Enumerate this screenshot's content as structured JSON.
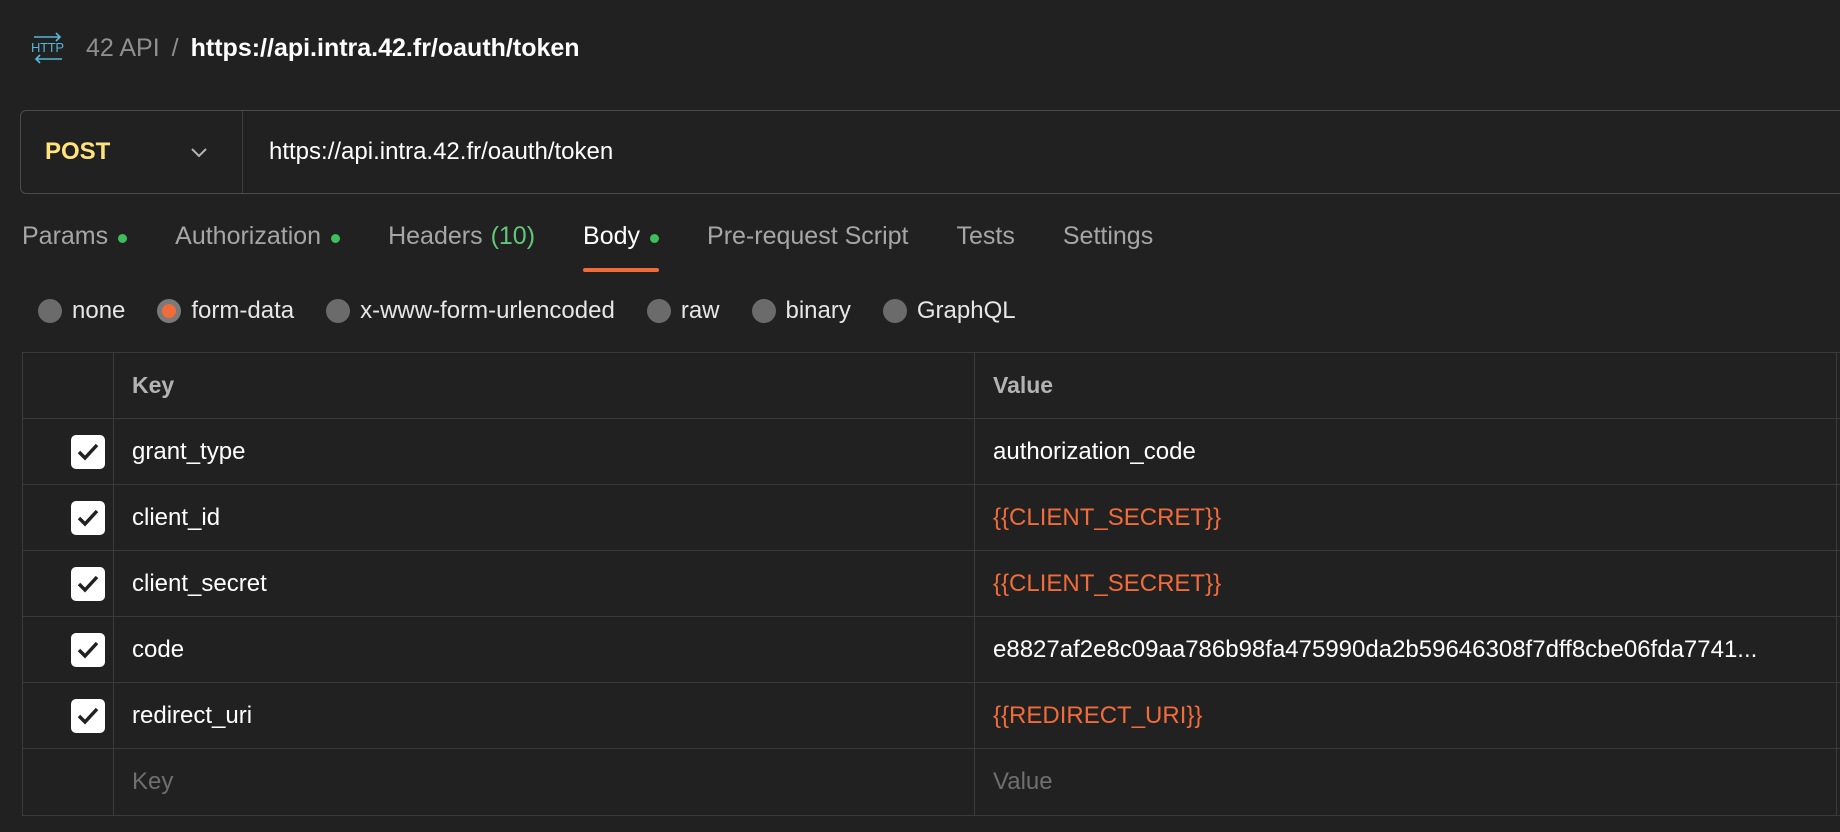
{
  "breadcrumb": {
    "icon": "http-icon",
    "parent": "42 API",
    "separator": "/",
    "current": "https://api.intra.42.fr/oauth/token"
  },
  "request": {
    "method": "POST",
    "url": "https://api.intra.42.fr/oauth/token"
  },
  "tabs": [
    {
      "label": "Params",
      "dot": true
    },
    {
      "label": "Authorization",
      "dot": true
    },
    {
      "label": "Headers",
      "count": "(10)"
    },
    {
      "label": "Body",
      "dot": true,
      "active": true
    },
    {
      "label": "Pre-request Script"
    },
    {
      "label": "Tests"
    },
    {
      "label": "Settings"
    }
  ],
  "body_types": {
    "selected": "form-data",
    "options": [
      "none",
      "form-data",
      "x-www-form-urlencoded",
      "raw",
      "binary",
      "GraphQL"
    ]
  },
  "table": {
    "headers": {
      "key": "Key",
      "value": "Value"
    },
    "rows": [
      {
        "checked": true,
        "key": "grant_type",
        "value": "authorization_code",
        "is_variable": false
      },
      {
        "checked": true,
        "key": "client_id",
        "value": "{{CLIENT_SECRET}}",
        "is_variable": true
      },
      {
        "checked": true,
        "key": "client_secret",
        "value": "{{CLIENT_SECRET}}",
        "is_variable": true
      },
      {
        "checked": true,
        "key": "code",
        "value": "e8827af2e8c09aa786b98fa475990da2b59646308f7dff8cbe06fda7741...",
        "is_variable": false
      },
      {
        "checked": true,
        "key": "redirect_uri",
        "value": "{{REDIRECT_URI}}",
        "is_variable": true
      }
    ],
    "placeholder": {
      "key": "Key",
      "value": "Value"
    }
  },
  "colors": {
    "background": "#212121",
    "accent": "#f26b3a",
    "method": "#ffe47e",
    "status_dot": "#3dbf59",
    "count": "#62c679"
  }
}
